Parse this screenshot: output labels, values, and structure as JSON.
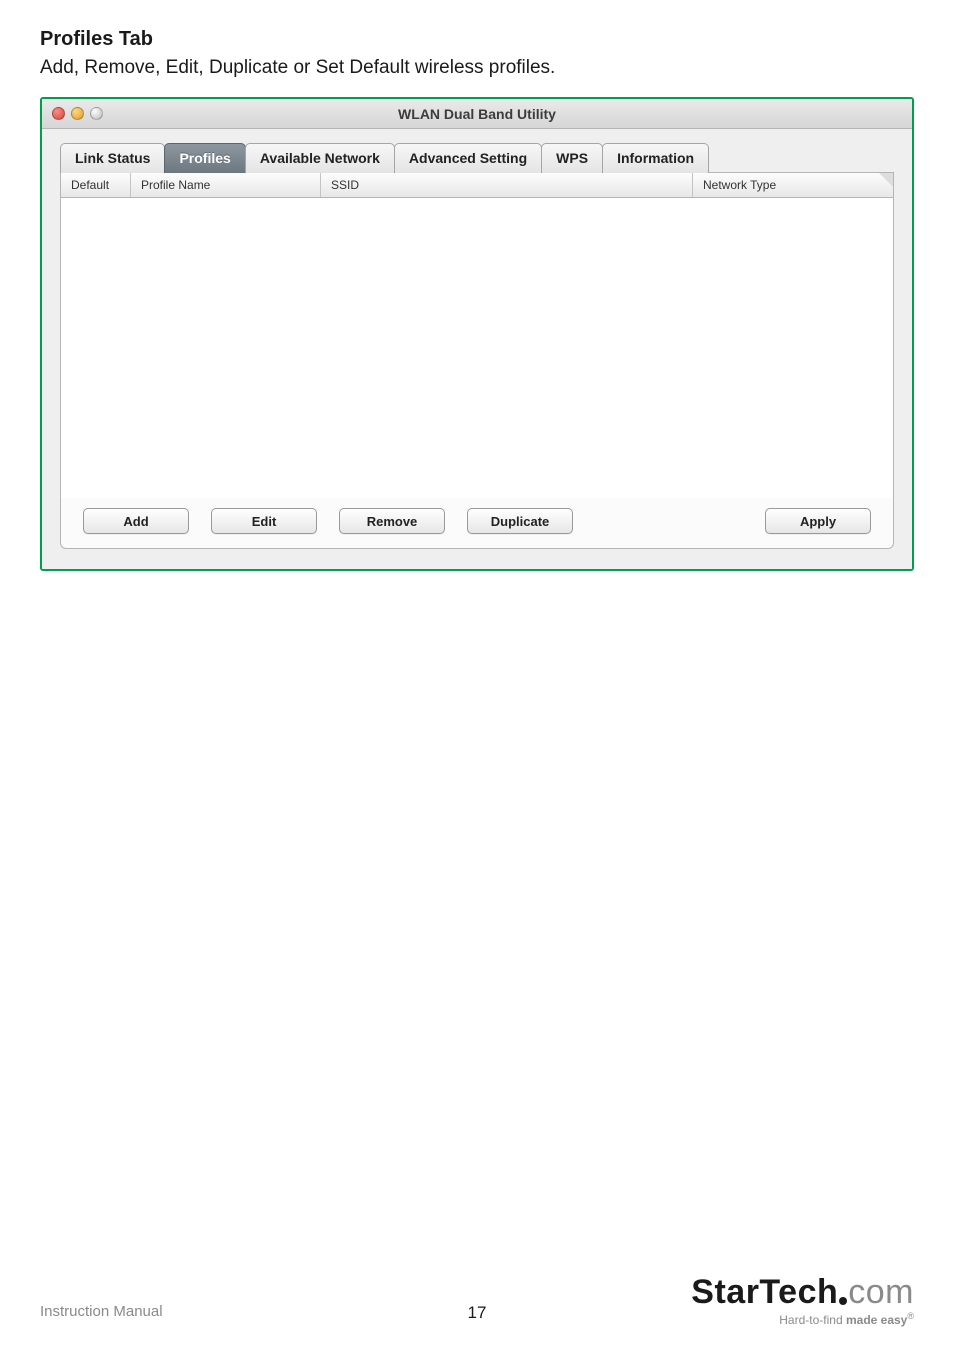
{
  "doc": {
    "section_title": "Profiles Tab",
    "section_desc": "Add, Remove, Edit, Duplicate or Set Default wireless profiles."
  },
  "window": {
    "title": "WLAN Dual Band Utility",
    "tabs": [
      {
        "label": "Link Status"
      },
      {
        "label": "Profiles"
      },
      {
        "label": "Available Network"
      },
      {
        "label": "Advanced Setting"
      },
      {
        "label": "WPS"
      },
      {
        "label": "Information"
      }
    ],
    "columns": {
      "default": "Default",
      "profile": "Profile Name",
      "ssid": "SSID",
      "type": "Network Type"
    },
    "buttons": {
      "add": "Add",
      "edit": "Edit",
      "remove": "Remove",
      "duplicate": "Duplicate",
      "apply": "Apply"
    }
  },
  "footer": {
    "label": "Instruction Manual",
    "page": "17",
    "brand_main": "StarTech",
    "brand_com": "com",
    "tagline_a": "Hard-to-find ",
    "tagline_b": "made easy",
    "reg": "®"
  }
}
